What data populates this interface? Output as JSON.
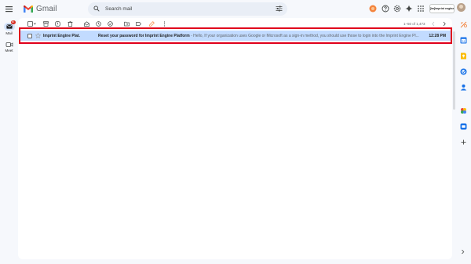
{
  "app": {
    "name": "Gmail"
  },
  "search": {
    "placeholder": "Search mail"
  },
  "account": {
    "label": "[im]imprint engine"
  },
  "nav": {
    "mail_label": "Mail",
    "mail_badge": "6",
    "meet_label": "Meet"
  },
  "toolbar": {
    "pagination": "1–50 of 1,473"
  },
  "emails": [
    {
      "sender": "Imprint Engine Plat.",
      "subject": "Reset your password for Imprint Engine Platform",
      "snippet": " - Hello, If your organization uses Google or Microsoft as a sign-in method, you should use those to login into the Imprint Engine Pl...",
      "time": "12:28 PM",
      "selected": true
    }
  ],
  "colors": {
    "selected_row": "#c2dbff",
    "highlight_outline": "#e0001b",
    "accent_red": "#d93025"
  }
}
